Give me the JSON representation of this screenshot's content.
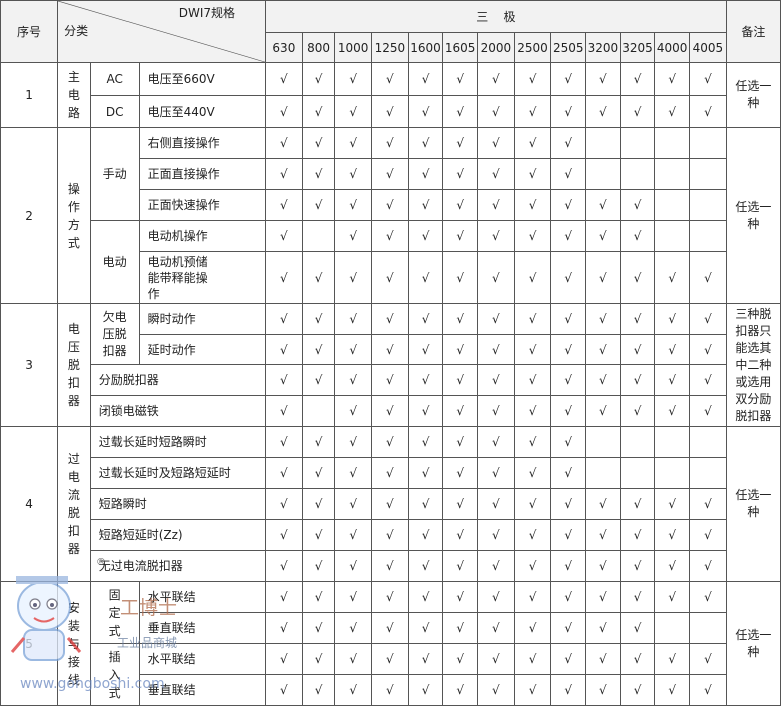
{
  "header": {
    "seq_label": "序号",
    "category_label": "分类",
    "spec_label": "DWI7规格",
    "pole_label": "三    极",
    "remark_label": "备注",
    "ratings": [
      "630",
      "800",
      "1000",
      "1250",
      "1600",
      "1605",
      "2000",
      "2500",
      "2505",
      "3200",
      "3205",
      "4000",
      "4005"
    ]
  },
  "check_mark": "√",
  "groups": {
    "g1": {
      "seq": "1",
      "name": "主电路",
      "remark": "任选一种"
    },
    "g2": {
      "seq": "2",
      "name": "操作方式",
      "remark": "任选一种",
      "sub_manual": "手动",
      "sub_motor": "电动"
    },
    "g3": {
      "seq": "3",
      "name": "电压脱扣器",
      "remark": "三种脱扣器只能选其中二种或选用双分励脱扣器",
      "sub_under": "欠电压脱扣器"
    },
    "g4": {
      "seq": "4",
      "name": "过电流脱扣器",
      "remark": "任选一种"
    },
    "g5": {
      "seq": "5",
      "name": "安装与接线",
      "remark": "任选一种",
      "sub_fixed": "固定式",
      "sub_plug": "插入式"
    }
  },
  "rows": [
    {
      "label": "AC",
      "desc": "电压至660V",
      "checks": [
        1,
        1,
        1,
        1,
        1,
        1,
        1,
        1,
        1,
        1,
        1,
        1,
        1
      ]
    },
    {
      "label": "DC",
      "desc": "电压至440V",
      "checks": [
        1,
        1,
        1,
        1,
        1,
        1,
        1,
        1,
        1,
        1,
        1,
        1,
        1
      ]
    },
    {
      "desc": "右侧直接操作",
      "checks": [
        1,
        1,
        1,
        1,
        1,
        1,
        1,
        1,
        1,
        0,
        0,
        0,
        0
      ]
    },
    {
      "desc": "正面直接操作",
      "checks": [
        1,
        1,
        1,
        1,
        1,
        1,
        1,
        1,
        1,
        0,
        0,
        0,
        0
      ]
    },
    {
      "desc": "正面快速操作",
      "checks": [
        1,
        1,
        1,
        1,
        1,
        1,
        1,
        1,
        1,
        1,
        1,
        0,
        0
      ]
    },
    {
      "desc": "电动机操作",
      "checks": [
        1,
        0,
        1,
        1,
        1,
        1,
        1,
        1,
        1,
        1,
        1,
        0,
        0
      ]
    },
    {
      "desc": "电动机预储能带释能操作",
      "checks": [
        1,
        1,
        1,
        1,
        1,
        1,
        1,
        1,
        1,
        1,
        1,
        1,
        1
      ]
    },
    {
      "desc": "瞬时动作",
      "checks": [
        1,
        1,
        1,
        1,
        1,
        1,
        1,
        1,
        1,
        1,
        1,
        1,
        1
      ]
    },
    {
      "desc": "延时动作",
      "checks": [
        1,
        1,
        1,
        1,
        1,
        1,
        1,
        1,
        1,
        1,
        1,
        1,
        1
      ]
    },
    {
      "desc": "分励脱扣器",
      "checks": [
        1,
        1,
        1,
        1,
        1,
        1,
        1,
        1,
        1,
        1,
        1,
        1,
        1
      ]
    },
    {
      "desc": "闭锁电磁铁",
      "checks": [
        1,
        0,
        1,
        1,
        1,
        1,
        1,
        1,
        1,
        1,
        1,
        1,
        1
      ]
    },
    {
      "desc": "过载长延时短路瞬时",
      "checks": [
        1,
        1,
        1,
        1,
        1,
        1,
        1,
        1,
        1,
        0,
        0,
        0,
        0
      ]
    },
    {
      "desc": "过载长延时及短路短延时",
      "checks": [
        1,
        1,
        1,
        1,
        1,
        1,
        1,
        1,
        1,
        0,
        0,
        0,
        0
      ]
    },
    {
      "desc": "短路瞬时",
      "checks": [
        1,
        1,
        1,
        1,
        1,
        1,
        1,
        1,
        1,
        1,
        1,
        1,
        1
      ]
    },
    {
      "desc": "短路短延时(Zz)",
      "checks": [
        1,
        1,
        1,
        1,
        1,
        1,
        1,
        1,
        1,
        1,
        1,
        1,
        1
      ]
    },
    {
      "desc": "无过电流脱扣器",
      "checks": [
        1,
        1,
        1,
        1,
        1,
        1,
        1,
        1,
        1,
        1,
        1,
        1,
        1
      ]
    },
    {
      "desc": "水平联结",
      "checks": [
        1,
        1,
        1,
        1,
        1,
        1,
        1,
        1,
        1,
        1,
        1,
        1,
        1
      ]
    },
    {
      "desc": "垂直联结",
      "checks": [
        1,
        1,
        1,
        1,
        1,
        1,
        1,
        1,
        1,
        1,
        1,
        0,
        0
      ]
    },
    {
      "desc": "水平联结",
      "checks": [
        1,
        1,
        1,
        1,
        1,
        1,
        1,
        1,
        1,
        1,
        1,
        1,
        1
      ]
    },
    {
      "desc": "垂直联结",
      "checks": [
        1,
        1,
        1,
        1,
        1,
        1,
        1,
        1,
        1,
        1,
        1,
        1,
        1
      ]
    }
  ],
  "watermark": {
    "brand": "工博士",
    "mall": "工业品商城",
    "url": "www.gongboshi.com",
    "registered": "®"
  }
}
